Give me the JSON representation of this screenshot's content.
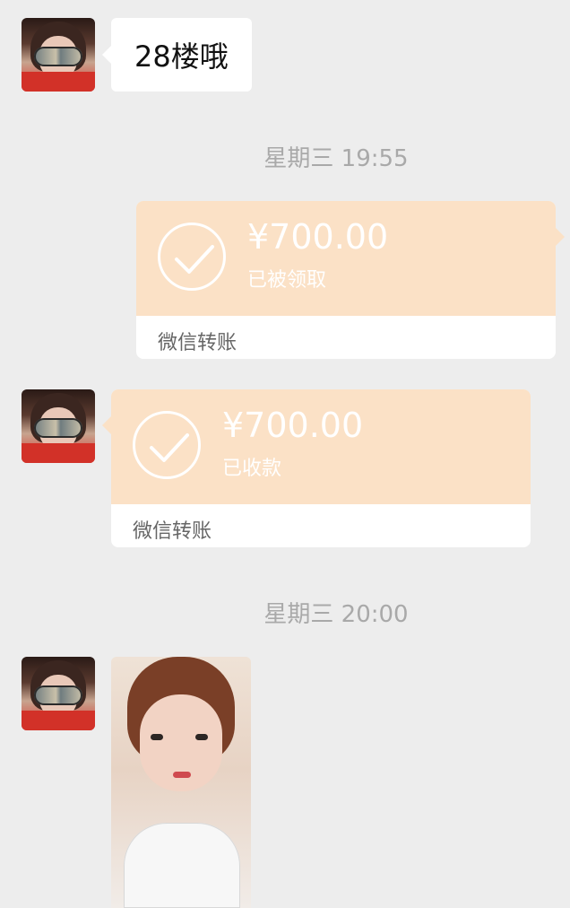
{
  "messages": [
    {
      "text": "28楼哦"
    }
  ],
  "timestamps": {
    "first": "星期三 19:55",
    "second": "星期三 20:00"
  },
  "transfers": {
    "sent": {
      "amount": "¥700.00",
      "status": "已被领取",
      "footer": "微信转账"
    },
    "received": {
      "amount": "¥700.00",
      "status": "已收款",
      "footer": "微信转账"
    }
  },
  "colors": {
    "background": "#ededed",
    "transfer_top": "#fbe1c6",
    "bubble": "#ffffff",
    "timestamp_text": "#a9a9a9"
  }
}
